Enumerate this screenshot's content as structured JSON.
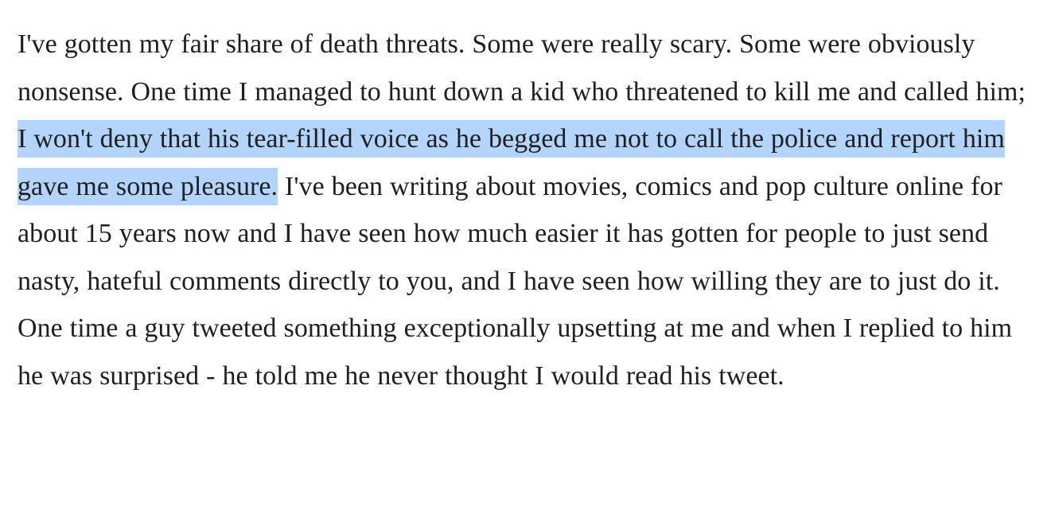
{
  "article": {
    "text_before_selection": "I've gotten my fair share of death threats. Some were really scary. Some were obviously nonsense. One time I managed to hunt down a kid who threatened to kill me and called him; ",
    "selected_text": "I won't deny that his tear-filled voice as he begged me not to call the police and report him gave me some pleasure.",
    "text_after_selection": " I've been writing about movies, comics and pop culture online for about 15 years now and I have seen how much easier it has gotten for people to just send nasty, hateful comments directly to you, and I have seen how willing they are to just do it. One time a guy tweeted something exceptionally upsetting at me and when I replied to him he was surprised - he told me he never thought I would read his tweet."
  },
  "colors": {
    "selection_highlight": "#b3d4fd",
    "text": "#1f1f1f",
    "background": "#ffffff"
  }
}
